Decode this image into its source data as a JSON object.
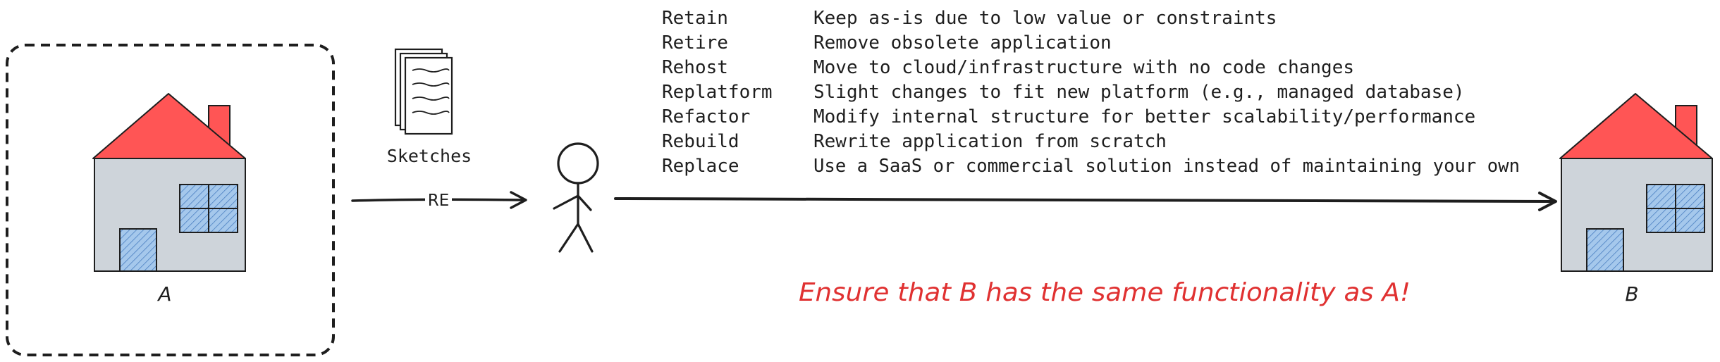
{
  "colors": {
    "stroke": "#1e1e1e",
    "roof": "#ff5555",
    "wall": "#ced4da",
    "window": "#a5c8ec",
    "note": "#e03131"
  },
  "icons": [
    "house-icon",
    "document-stack-icon",
    "stick-figure-icon",
    "arrow-icon"
  ],
  "house_a": {
    "label": "A"
  },
  "house_b": {
    "label": "B"
  },
  "sketches": {
    "label": "Sketches"
  },
  "re_arrow": {
    "label": "RE"
  },
  "strategies": [
    {
      "name": "Retain",
      "description": "Keep as-is due to low value or constraints"
    },
    {
      "name": "Retire",
      "description": "Remove obsolete application"
    },
    {
      "name": "Rehost",
      "description": "Move to cloud/infrastructure with no code changes"
    },
    {
      "name": "Replatform",
      "description": "Slight changes to fit new platform (e.g., managed database)"
    },
    {
      "name": "Refactor",
      "description": "Modify internal structure for better scalability/performance"
    },
    {
      "name": "Rebuild",
      "description": "Rewrite application from scratch"
    },
    {
      "name": "Replace",
      "description": "Use a SaaS or commercial solution instead of maintaining your own"
    }
  ],
  "note": {
    "text": "Ensure that B has the same functionality as A!"
  }
}
